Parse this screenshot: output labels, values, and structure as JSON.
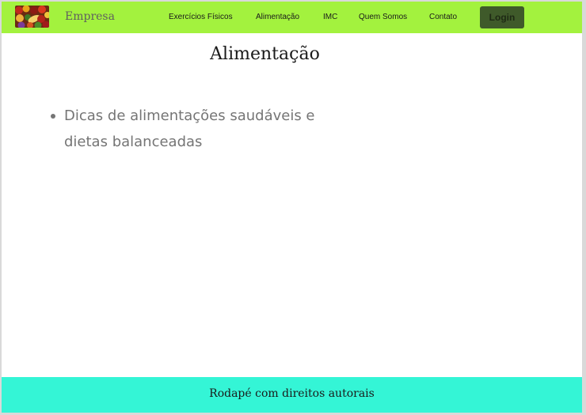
{
  "navbar": {
    "brand": "Empresa",
    "logo_icon": "fruits-logo-icon",
    "links": [
      "Exercícios Físicos",
      "Alimentação",
      "IMC",
      "Quem Somos",
      "Contato"
    ],
    "login_label": "Login",
    "background_color": "#a3f23e",
    "login_color": "#3f5a2a"
  },
  "main": {
    "title": "Alimentação",
    "items": [
      "Dicas de alimentações saudáveis e dietas balanceadas"
    ]
  },
  "footer": {
    "text": "Rodapé com direitos autorais",
    "background_color": "#34f5d6"
  }
}
